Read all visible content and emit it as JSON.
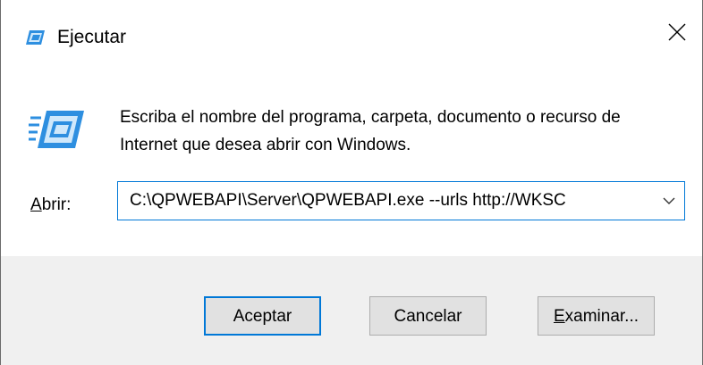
{
  "window": {
    "title": "Ejecutar",
    "close_glyph": "✕"
  },
  "dialog": {
    "description": "Escriba el nombre del programa, carpeta, documento o recurso de Internet que desea abrir con Windows.",
    "open_label_access": "A",
    "open_label_rest": "brir:",
    "open_value": "C:\\QPWEBAPI\\Server\\QPWEBAPI.exe --urls http://WKSC",
    "icons": {
      "title": "run-icon",
      "big": "run-icon",
      "dropdown": "chevron-down-icon",
      "close": "close-icon"
    }
  },
  "buttons": {
    "ok": "Aceptar",
    "cancel": "Cancelar",
    "browse_access": "E",
    "browse_rest": "xaminar..."
  },
  "colors": {
    "accent": "#0078d7",
    "footer_bg": "#f0f0f0",
    "button_bg": "#e1e1e1"
  }
}
